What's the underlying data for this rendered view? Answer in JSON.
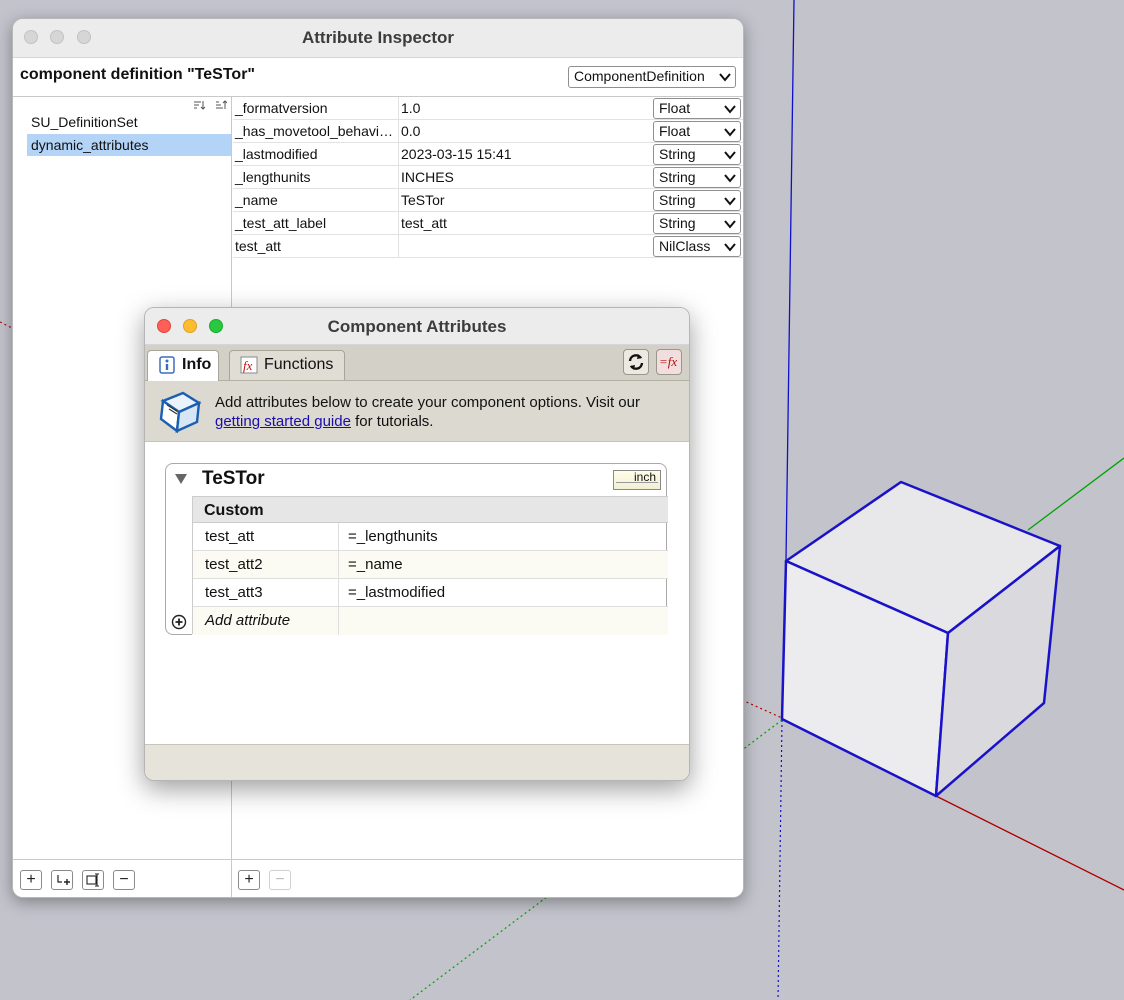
{
  "inspector": {
    "title": "Attribute Inspector",
    "definition_label": "component definition \"TeSTor\"",
    "type_select": "ComponentDefinition",
    "dictionaries": [
      "SU_DefinitionSet",
      "dynamic_attributes"
    ],
    "selected_dictionary": "dynamic_attributes",
    "attributes": [
      {
        "key": "_formatversion",
        "value": "1.0",
        "type": "Float"
      },
      {
        "key": "_has_movetool_behaviors",
        "value": "0.0",
        "type": "Float"
      },
      {
        "key": "_lastmodified",
        "value": "2023-03-15 15:41",
        "type": "String"
      },
      {
        "key": "_lengthunits",
        "value": "INCHES",
        "type": "String"
      },
      {
        "key": "_name",
        "value": "TeSTor",
        "type": "String"
      },
      {
        "key": "_test_att_label",
        "value": "test_att",
        "type": "String"
      },
      {
        "key": "test_att",
        "value": "",
        "type": "NilClass"
      }
    ],
    "bottom_buttons_left": [
      "+",
      "+",
      "",
      "−"
    ],
    "bottom_buttons_right": [
      "+",
      "−"
    ]
  },
  "component_attributes": {
    "title": "Component Attributes",
    "tabs": [
      {
        "label": "Info",
        "active": true
      },
      {
        "label": "Functions",
        "active": false
      }
    ],
    "banner": {
      "text_before": "Add attributes below to create your component options. Visit our",
      "link_text": "getting started guide",
      "text_after": "for tutorials."
    },
    "component_name": "TeSTor",
    "unit_badge": "inch",
    "section_header": "Custom",
    "rows": [
      {
        "name": "test_att",
        "formula": "=_lengthunits"
      },
      {
        "name": "test_att2",
        "formula": "=_name"
      },
      {
        "name": "test_att3",
        "formula": "=_lastmodified"
      }
    ],
    "add_attribute_label": "Add attribute"
  },
  "colors": {
    "viewport_bg": "#c3c3cc",
    "blue_axis": "#1010cc",
    "green_axis": "#00a000",
    "red_axis": "#b00000",
    "selection_blue": "#b3d4f6"
  }
}
